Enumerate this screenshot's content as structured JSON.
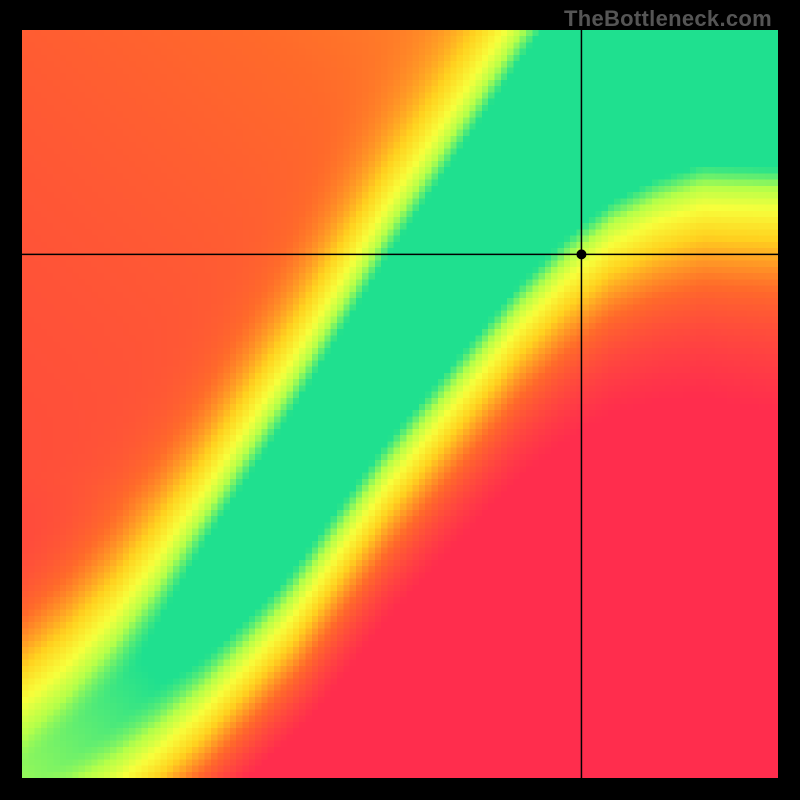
{
  "watermark": "TheBottleneck.com",
  "chart_data": {
    "type": "heatmap",
    "title": "",
    "xlabel": "",
    "ylabel": "",
    "xlim": [
      0,
      1
    ],
    "ylim": [
      0,
      1
    ],
    "grid": false,
    "legend": false,
    "resolution": {
      "width": 120,
      "height": 120
    },
    "crosshair": {
      "x": 0.74,
      "y": 0.7
    },
    "marker": {
      "x": 0.74,
      "y": 0.7
    },
    "colorscale": [
      {
        "t": 0.0,
        "hex": "#ff2d4d"
      },
      {
        "t": 0.25,
        "hex": "#ff6a2a"
      },
      {
        "t": 0.5,
        "hex": "#ffd21f"
      },
      {
        "t": 0.7,
        "hex": "#f7ff3c"
      },
      {
        "t": 0.85,
        "hex": "#b6ff49"
      },
      {
        "t": 1.0,
        "hex": "#1fe08f"
      }
    ],
    "ridge": {
      "points": [
        {
          "x": 0.0,
          "y": 0.0
        },
        {
          "x": 0.06,
          "y": 0.04
        },
        {
          "x": 0.12,
          "y": 0.09
        },
        {
          "x": 0.18,
          "y": 0.15
        },
        {
          "x": 0.24,
          "y": 0.22
        },
        {
          "x": 0.3,
          "y": 0.3
        },
        {
          "x": 0.36,
          "y": 0.38
        },
        {
          "x": 0.42,
          "y": 0.47
        },
        {
          "x": 0.48,
          "y": 0.56
        },
        {
          "x": 0.54,
          "y": 0.64
        },
        {
          "x": 0.6,
          "y": 0.72
        },
        {
          "x": 0.66,
          "y": 0.8
        },
        {
          "x": 0.72,
          "y": 0.87
        },
        {
          "x": 0.78,
          "y": 0.93
        },
        {
          "x": 0.84,
          "y": 0.97
        },
        {
          "x": 0.9,
          "y": 1.0
        }
      ],
      "half_width": [
        0.01,
        0.015,
        0.02,
        0.027,
        0.036,
        0.045,
        0.052,
        0.056,
        0.06,
        0.064,
        0.068,
        0.072,
        0.078,
        0.085,
        0.092,
        0.1
      ],
      "falloff": 0.2,
      "edge_boost": {
        "top_right": 0.3,
        "bottom_left": -0.5
      }
    }
  }
}
